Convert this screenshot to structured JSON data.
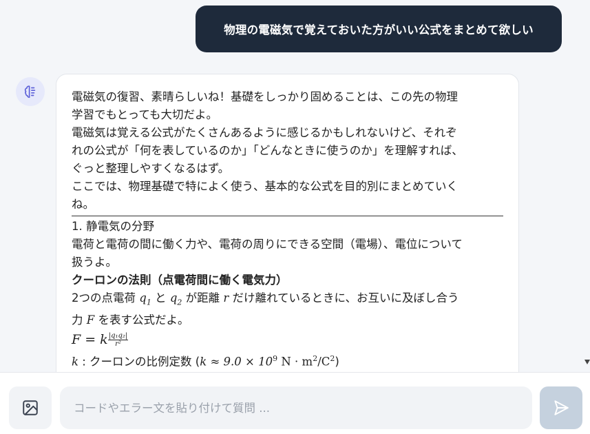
{
  "user_message": "物理の電磁気で覚えておいた方がいい公式をまとめて欲しい",
  "assistant": {
    "intro_lines": [
      "電磁気の復習、素晴らしいね！基礎をしっかり固めることは、この先の物理",
      "学習でもとっても大切だよ。",
      "電磁気は覚える公式がたくさんあるように感じるかもしれないけど、それぞ",
      "れの公式が「何を表しているのか」「どんなときに使うのか」を理解すれば、",
      "ぐっと整理しやすくなるはず。",
      "ここでは、物理基礎で特によく使う、基本的な公式を目的別にまとめていく",
      "ね。"
    ],
    "section_title": "1. 静電気の分野",
    "section_desc_lines": [
      "電荷と電荷の間に働く力や、電荷の周りにできる空間（電場）、電位について",
      "扱うよ。"
    ],
    "law_title": "クーロンの法則（点電荷間に働く電気力）",
    "law_desc": {
      "p1": "2つの点電荷 ",
      "q1": "q",
      "q1_sub": "1",
      "p2": " と ",
      "q2": "q",
      "q2_sub": "2",
      "p3": " が距離 ",
      "r": "r",
      "p4": " だけ離れているときに、お互いに及ぼし合う",
      "p5": "力 ",
      "F": "F",
      "p6": " を表す公式だよ。"
    },
    "formula": {
      "lhs": "F = k",
      "num": "|q₁q₂|",
      "den": "r²"
    },
    "constant_line": {
      "k": "k",
      "label": " : クーロンの比例定数 (",
      "expr": "k ≈ 9.0 × 10",
      "exp": "9",
      "units": " N · m",
      "units_exp": "2",
      "units_tail": "/C",
      "units_tail_exp": "2",
      "close": ")"
    }
  },
  "input": {
    "placeholder": "コードやエラー文を貼り付けて質問 ..."
  },
  "icons": {
    "avatar": "brain-icon",
    "image_upload": "image-icon",
    "send": "send-icon"
  },
  "colors": {
    "user_bubble": "#1e2a3b",
    "send_button": "#c5d1de",
    "avatar_bg": "#e6e9fb",
    "avatar_icon": "#5b5fd8"
  }
}
